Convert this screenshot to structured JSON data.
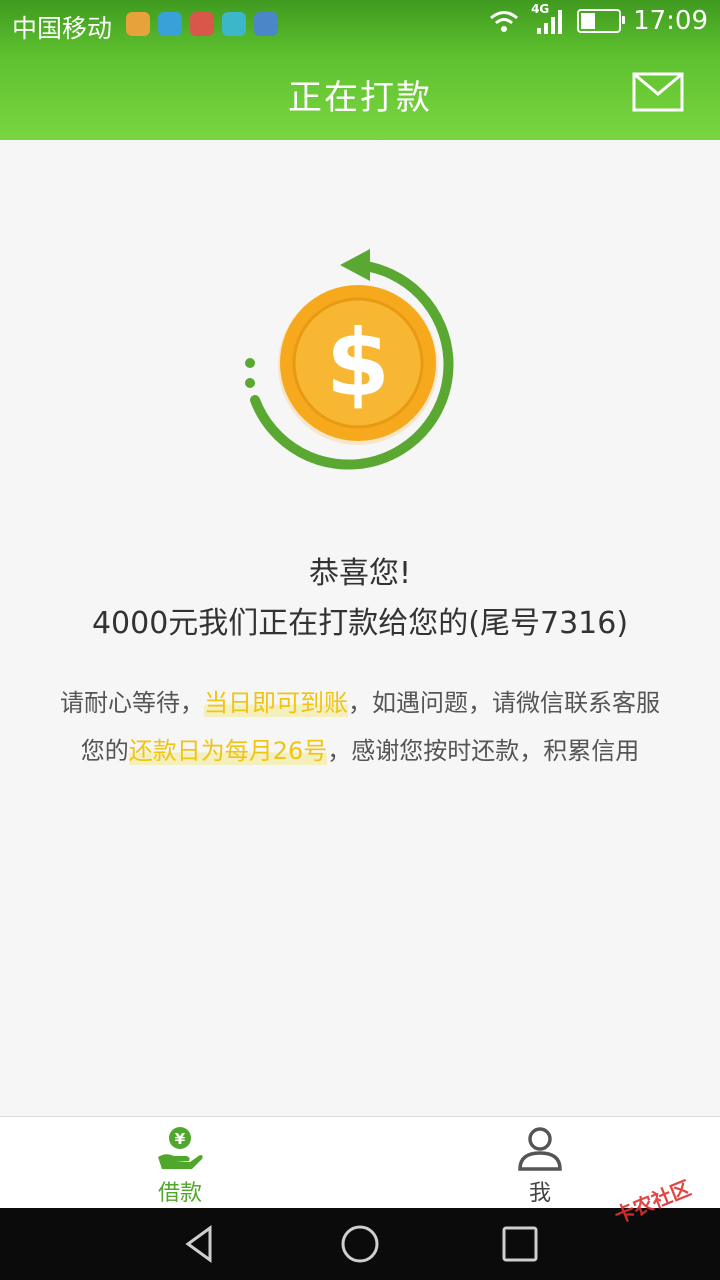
{
  "status_bar": {
    "carrier": "中国移动",
    "network": "4G",
    "time": "17:09"
  },
  "header": {
    "title": "正在打款",
    "mail_icon": "mail-icon"
  },
  "illustration": {
    "icon": "dollar-coin-icon",
    "symbol": "$"
  },
  "message": {
    "congrats": "恭喜您!",
    "amount_line": "4000元我们正在打款给您的(尾号7316)",
    "line1_prefix": "请耐心等待，",
    "line1_highlight": "当日即可到账",
    "line1_suffix": "，如遇问题，请微信联系客服",
    "line2_prefix": "您的",
    "line2_highlight": "还款日为每月26号",
    "line2_suffix": "，感谢您按时还款，积累信用"
  },
  "tabs": [
    {
      "label": "借款",
      "icon": "loan-yen-icon",
      "active": true
    },
    {
      "label": "我",
      "icon": "user-icon",
      "active": false
    }
  ],
  "watermark": "卡农社区",
  "colors": {
    "header_green": "#5ec12f",
    "arrow_green": "#5aa832",
    "coin_orange": "#f6a91c",
    "highlight_yellow": "#f1c413",
    "active_tab": "#4fa72c"
  }
}
